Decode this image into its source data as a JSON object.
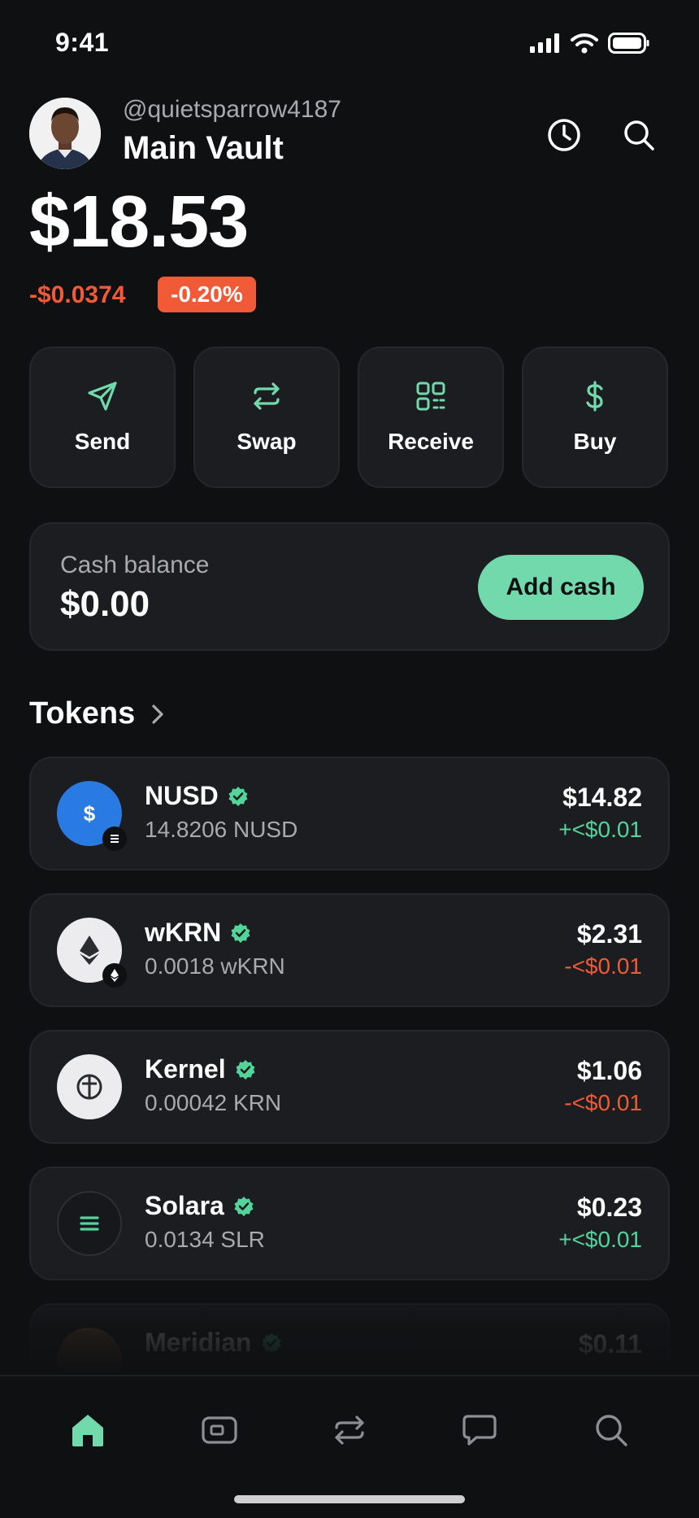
{
  "status": {
    "time": "9:41"
  },
  "header": {
    "username": "@quietsparrow4187",
    "vault_name": "Main Vault",
    "balance": "$18.53",
    "change_value": "-$0.0374",
    "change_percent": "-0.20%"
  },
  "actions": [
    {
      "label": "Send",
      "icon": "send-icon"
    },
    {
      "label": "Swap",
      "icon": "swap-icon"
    },
    {
      "label": "Receive",
      "icon": "qr-icon"
    },
    {
      "label": "Buy",
      "icon": "dollar-icon"
    }
  ],
  "cash": {
    "label": "Cash balance",
    "amount": "$0.00",
    "button": "Add cash"
  },
  "tokens_section": {
    "title": "Tokens"
  },
  "tokens": [
    {
      "name": "NUSD",
      "amount": "14.8206 NUSD",
      "value": "$14.82",
      "change": "+<$0.01",
      "trend": "pos"
    },
    {
      "name": "wKRN",
      "amount": "0.0018 wKRN",
      "value": "$2.31",
      "change": "-<$0.01",
      "trend": "neg"
    },
    {
      "name": "Kernel",
      "amount": "0.00042 KRN",
      "value": "$1.06",
      "change": "-<$0.01",
      "trend": "neg"
    },
    {
      "name": "Solara",
      "amount": "0.0134 SLR",
      "value": "$0.23",
      "change": "+<$0.01",
      "trend": "pos"
    },
    {
      "name": "Meridian",
      "amount": "",
      "value": "$0.11",
      "change": "",
      "trend": "pos"
    }
  ],
  "colors": {
    "accent": "#72d9ad",
    "negative": "#f05a36",
    "positive": "#52d49a",
    "card": "#1c1d20",
    "background": "#0f1012"
  },
  "tabbar": [
    "home-icon",
    "card-icon",
    "swap-icon",
    "chat-icon",
    "search-icon"
  ]
}
